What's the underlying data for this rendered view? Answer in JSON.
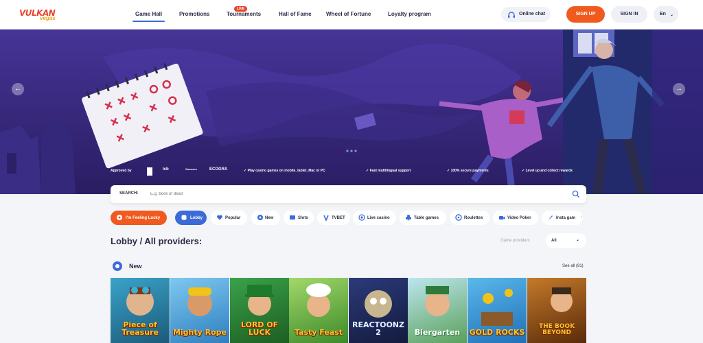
{
  "header": {
    "logo_text": "VULKAN",
    "logo_sub": "vegas",
    "nav": [
      {
        "label": "Game Hall"
      },
      {
        "label": "Promotions"
      },
      {
        "label": "Tournaments"
      },
      {
        "label": "Hall of Fame"
      },
      {
        "label": "Wheel of Fortune"
      },
      {
        "label": "Loyalty program"
      }
    ],
    "live_badge": "LIVE",
    "online_chat": "Online chat",
    "sign_up": "SIGN UP",
    "sign_in": "SIGN IN",
    "language": "En"
  },
  "hero": {
    "approved_by": "Approved by",
    "partners": [
      "lcb",
      "Gamcare",
      "ECOGRA"
    ],
    "features": [
      "Play casino games on mobile, tablet, Mac or PC",
      "Fast multilingual support",
      "100% secure payments",
      "Level up and collect rewards"
    ]
  },
  "search": {
    "label": "SEARCH:",
    "placeholder": "E.g. book of dead"
  },
  "categories": [
    {
      "label": "I'm Feeling Lucky",
      "icon": "lucky-icon"
    },
    {
      "label": "Lobby",
      "icon": "lobby-icon"
    },
    {
      "label": "Popular",
      "icon": "heart-icon"
    },
    {
      "label": "New",
      "icon": "new-icon"
    },
    {
      "label": "Slots",
      "icon": "slots-icon"
    },
    {
      "label": "TVBET",
      "icon": "tvbet-icon"
    },
    {
      "label": "Live casino",
      "icon": "live-icon"
    },
    {
      "label": "Table games",
      "icon": "club-icon"
    },
    {
      "label": "Roulettes",
      "icon": "roulette-icon"
    },
    {
      "label": "Video Poker",
      "icon": "video-icon"
    },
    {
      "label": "Insta gam",
      "icon": "rocket-icon"
    }
  ],
  "lobby": {
    "title": "Lobby / All providers:",
    "providers_label": "Game providers",
    "providers_value": "All"
  },
  "new_section": {
    "title": "New",
    "see_all": "See all (91)",
    "games": [
      {
        "name": "Piece of Treasure"
      },
      {
        "name": "Mighty Rope"
      },
      {
        "name": "LORD OF LUCK"
      },
      {
        "name": "Tasty Feast"
      },
      {
        "name": "REACTOONZ 2"
      },
      {
        "name": "Biergarten"
      },
      {
        "name": "GOLD ROCKS"
      },
      {
        "name": "THE BOOK BEYOND"
      }
    ]
  },
  "colors": {
    "accent_orange": "#f05a1e",
    "accent_blue": "#3b6bd6",
    "hero_purple": "#2f2270"
  }
}
